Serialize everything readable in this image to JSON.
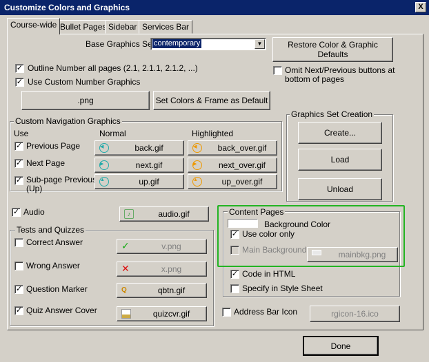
{
  "window": {
    "title": "Customize Colors and Graphics",
    "close_label": "X"
  },
  "tabs": [
    {
      "label": "Course-wide",
      "active": true
    },
    {
      "label": "Bullet Pages"
    },
    {
      "label": "Sidebar"
    },
    {
      "label": "Services Bar"
    }
  ],
  "base_graphics": {
    "label": "Base Graphics Set",
    "value": "contemporary"
  },
  "restore_button": "Restore Color & Graphic Defaults",
  "outline_number": {
    "label": "Outline Number all pages (2.1, 2.1.1, 2.1.2, ...)",
    "checked": true
  },
  "custom_number": {
    "label": "Use Custom Number Graphics",
    "checked": true
  },
  "omit_next_prev": {
    "label_line1": "Omit Next/Previous buttons at",
    "label_line2": "bottom of pages",
    "checked": false
  },
  "png_button": ".png",
  "set_colors_button": "Set Colors & Frame as Default",
  "nav_graphics": {
    "title": "Custom Navigation Graphics",
    "col_use": "Use",
    "col_normal": "Normal",
    "col_highlighted": "Highlighted",
    "rows": [
      {
        "label": "Previous Page",
        "checked": true,
        "normal": "back.gif",
        "highlighted": "back_over.gif"
      },
      {
        "label": "Next Page",
        "checked": true,
        "normal": "next.gif",
        "highlighted": "next_over.gif"
      },
      {
        "label_line1": "Sub-page Previous",
        "label_line2": "(Up)",
        "checked": true,
        "normal": "up.gif",
        "highlighted": "up_over.gif"
      }
    ]
  },
  "graphics_set": {
    "title": "Graphics Set Creation",
    "create": "Create...",
    "load": "Load",
    "unload": "Unload"
  },
  "audio": {
    "label": "Audio",
    "checked": true,
    "file": "audio.gif"
  },
  "tests": {
    "title": "Tests and Quizzes",
    "items": [
      {
        "label": "Correct Answer",
        "checked": false,
        "file": "v.png",
        "disabled": true
      },
      {
        "label": "Wrong Answer",
        "checked": false,
        "file": "x.png",
        "disabled": true
      },
      {
        "label": "Question Marker",
        "checked": true,
        "file": "qbtn.gif",
        "disabled": false
      },
      {
        "label": "Quiz Answer Cover",
        "checked": true,
        "file": "quizcvr.gif",
        "disabled": false
      }
    ]
  },
  "content_pages": {
    "title": "Content Pages",
    "background_color_label": "Background Color",
    "use_color_only": {
      "label": "Use color only",
      "checked": true
    },
    "main_background": {
      "label": "Main Background",
      "checked": false,
      "file": "mainbkg.png"
    },
    "code_in_html": {
      "label": "Code in HTML",
      "checked": true
    },
    "style_sheet": {
      "label": "Specify in Style Sheet",
      "checked": false
    }
  },
  "address_bar": {
    "label": "Address Bar Icon",
    "checked": false,
    "file": "rgicon-16.ico"
  },
  "done_button": "Done",
  "colors": {
    "title_bar": "#0a246a",
    "face": "#d4d0c8",
    "highlight_border": "#22b422"
  }
}
